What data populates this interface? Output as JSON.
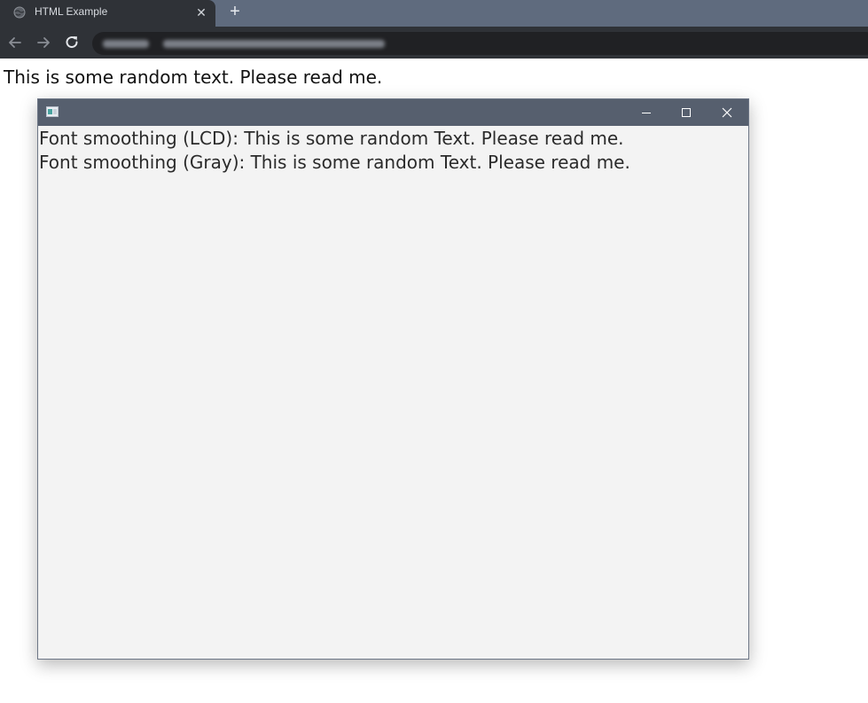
{
  "browser": {
    "tab_title": "HTML Example",
    "tab_close": "✕",
    "new_tab": "+"
  },
  "page": {
    "text": "This is some random text. Please read me."
  },
  "window": {
    "lines": [
      "Font smoothing (LCD): This is some random Text. Please read me.",
      "Font smoothing (Gray): This is some random Text. Please read me."
    ]
  },
  "colors": {
    "tab_strip": "#5f6b7e",
    "toolbar": "#2f3237",
    "window_titlebar": "#565f6e",
    "window_body": "#f3f3f3"
  }
}
